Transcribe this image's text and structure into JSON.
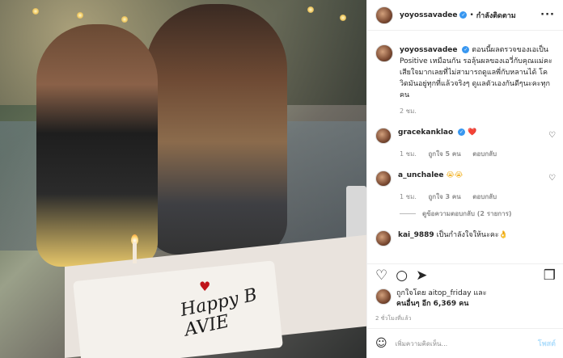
{
  "header": {
    "username": "yoyossavadee",
    "separator": "•",
    "follow_label": "กำลังติดตาม",
    "more_icon": "more-icon"
  },
  "photo": {
    "cake_text": "Happy B",
    "cake_name": "AVIE"
  },
  "caption": {
    "username": "yoyossavadee",
    "text": "ตอนนี้ผลตรวจของเอเป็น Positive เหมือนกัน รอลุ้นผลของเอวี่กับคุณแม่คะ เสียใจมากเลยที่ไม่สามารถดูแลพี่กับหลานได้ โควิดมันอยู่ทุกที่แล้วจริงๆ ดูแลตัวเองกันดีๆนะคะทุกคน",
    "time": "2 ชม."
  },
  "comments": [
    {
      "username": "gracekanklao",
      "text": "❤️",
      "time": "1 ชม.",
      "likes": "ถูกใจ 5 คน",
      "reply": "ตอบกลับ"
    },
    {
      "username": "a_unchalee",
      "text": "😭😭",
      "time": "1 ชม.",
      "likes": "ถูกใจ 3 คน",
      "reply": "ตอบกลับ"
    },
    {
      "username": "kai_9889",
      "text": "เป็นกำลังใจให้นะคะ👌"
    }
  ],
  "view_replies": "ดูข้อความตอบกลับ (2 รายการ)",
  "actions": {
    "like_icon": "heart-outline-icon",
    "comment_icon": "comment-icon",
    "share_icon": "share-icon",
    "save_icon": "bookmark-icon"
  },
  "likes": {
    "line1": "ถูกใจโดย aitop_friday และ",
    "line2": "คนอื่นๆ อีก 6,369 คน"
  },
  "post_time": "2 ชั่วโมงที่แล้ว",
  "add_comment": {
    "placeholder": "เพิ่มความคิดเห็น...",
    "post_label": "โพสต์"
  },
  "colors": {
    "verified": "#3897f0",
    "post_disabled": "#b2dffc",
    "meta_gray": "#8e8e8e"
  }
}
